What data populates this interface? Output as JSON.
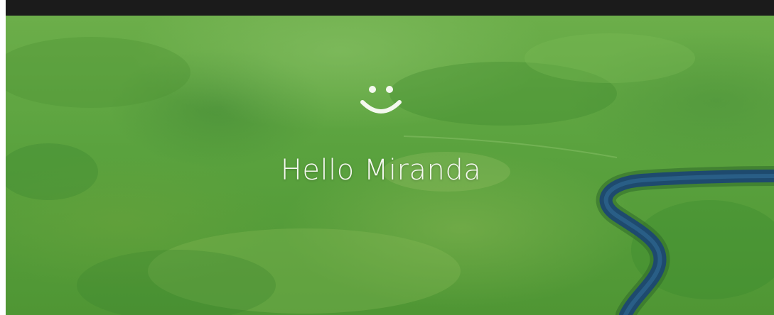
{
  "lock_screen": {
    "greeting_text": "Hello Miranda",
    "recognition_icon": "smiley-face-icon",
    "wallpaper": "aerial-green-wetland-with-river"
  },
  "colors": {
    "top_bar": "#1b1b1b",
    "grass_light": "#6cae4a",
    "grass_dark": "#4f9634",
    "river": "#1e4a6e",
    "text": "#f4f8ef"
  }
}
